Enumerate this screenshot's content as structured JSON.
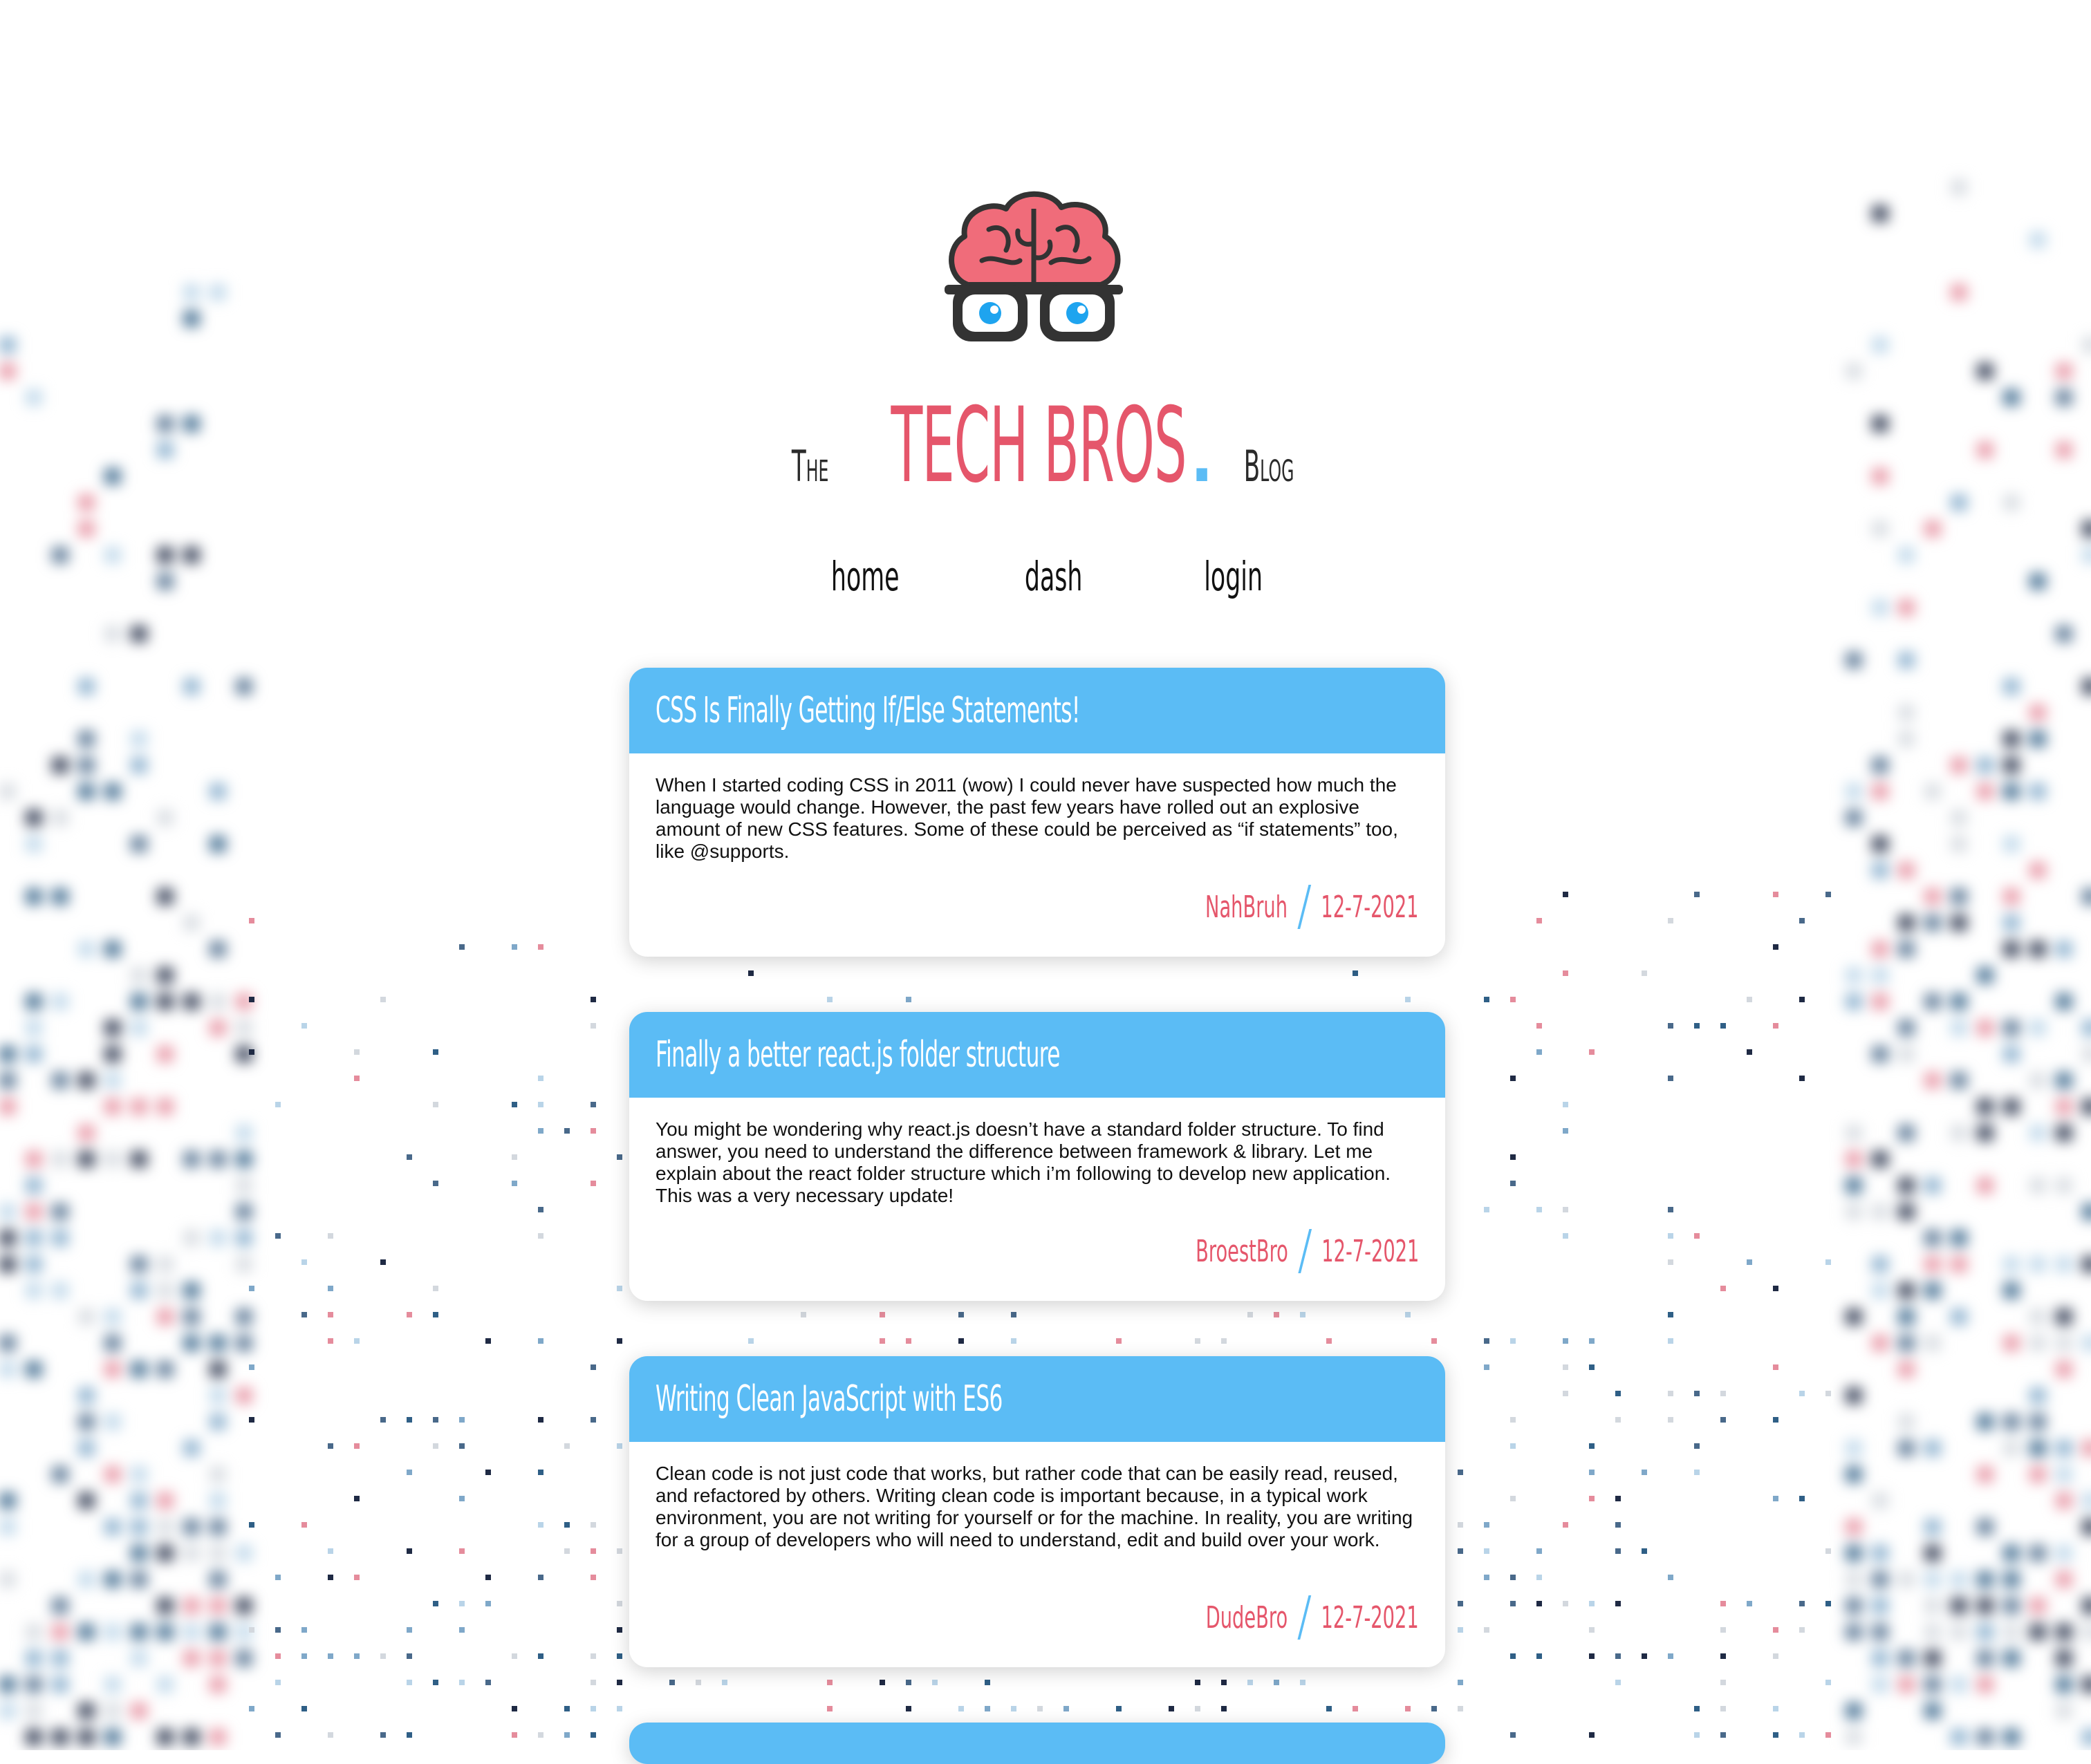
{
  "site": {
    "title_prefix": "The",
    "title_main": "TECH BROS",
    "title_dot": ".",
    "title_suffix": "Blog"
  },
  "nav": {
    "home": "home",
    "dash": "dash",
    "login": "login"
  },
  "posts": [
    {
      "title": "CSS Is Finally Getting If/Else Statements!",
      "excerpt": "When I started coding CSS in 2011 (wow) I could never have suspected how much the language would change. However, the past few years have rolled out an explosive amount of new CSS features. Some of these could be perceived as “if statements” too, like @supports.",
      "author": "NahBruh",
      "date": "12-7-2021"
    },
    {
      "title": "Finally a better react.js folder structure",
      "excerpt": "You might be wondering why react.js doesn’t have a standard folder structure. To find answer, you need to understand the difference between framework & library. Let me explain about the react folder structure which i’m following to develop new application. This was a very necessary update!",
      "author": "BroestBro",
      "date": "12-7-2021"
    },
    {
      "title": "Writing Clean JavaScript with ES6",
      "excerpt": "Clean code is not just code that works, but rather code that can be easily read, reused, and refactored by others. Writing clean code is important because, in a typical work environment, you are not writing for yourself or for the machine. In reality, you are writing for a group of developers who will need to understand, edit and build over your work.",
      "author": "DudeBro",
      "date": "12-7-2021"
    }
  ],
  "colors": {
    "accent_blue": "#5bbcf5",
    "accent_red": "#e5566b",
    "dark": "#2a2a2a"
  },
  "icons": {
    "logo": "brain-with-glasses-icon"
  }
}
